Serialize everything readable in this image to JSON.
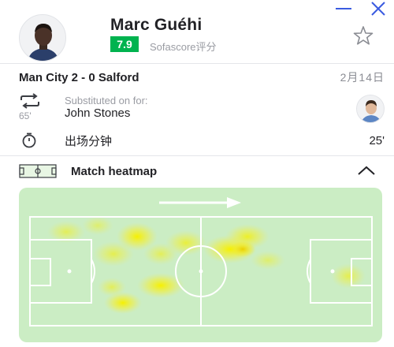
{
  "window": {
    "minimize_icon": "minimize-icon",
    "close_icon": "close-icon",
    "accent_color": "#3a5be0"
  },
  "player": {
    "name": "Marc Guéhi",
    "rating": "7.9",
    "rating_label": "Sofascore评分",
    "rating_color": "#00b34f",
    "favorite_icon": "star-outline-icon"
  },
  "match": {
    "score_line": "Man City 2 - 0 Salford",
    "date": "2月14日"
  },
  "substitution": {
    "icon": "substitution-icon",
    "minute": "65'",
    "label": "Substituted on for:",
    "player_name": "John Stones"
  },
  "minutes_played": {
    "icon": "stopwatch-icon",
    "label": "出场分钟",
    "value": "25'"
  },
  "heatmap": {
    "icon": "pitch-icon",
    "title": "Match heatmap",
    "toggle_icon": "chevron-up-icon",
    "attack_direction_icon": "arrow-right-icon",
    "pitch_color": "#cbedc4",
    "heat_color": "#f6f000"
  }
}
